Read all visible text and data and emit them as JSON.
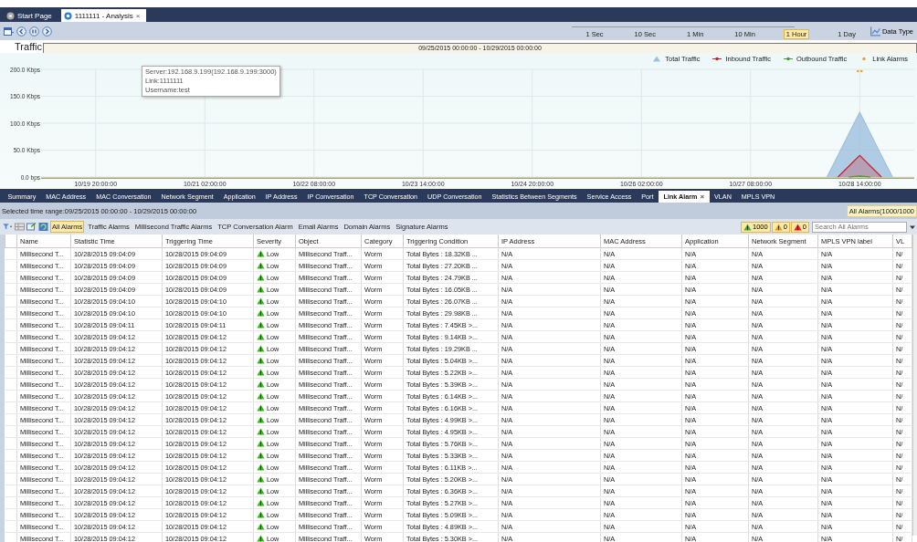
{
  "tabs": [
    {
      "label": "Start Page",
      "selected": false
    },
    {
      "label": "1111111 - Analysis",
      "selected": true,
      "close_mark": "×"
    }
  ],
  "toolbar": {
    "time_scale": [
      {
        "label": "1 Sec",
        "selected": false
      },
      {
        "label": "10 Sec",
        "selected": false
      },
      {
        "label": "1 Min",
        "selected": false
      },
      {
        "label": "10 Min",
        "selected": false
      },
      {
        "label": "1 Hour",
        "selected": true
      },
      {
        "label": "1 Day",
        "selected": false
      }
    ],
    "data_type": "Data Type"
  },
  "tooltip": {
    "lines": [
      "Server:192.168.9.199(192.168.9.199:3000)",
      "Link:1111111",
      "Username:test"
    ]
  },
  "traffic": {
    "title": "Traffic",
    "range": "09/25/2015 00:00:00 - 10/29/2015 00:00:00",
    "alarm_legend": {
      "label": "Link Alarms",
      "color": "#f0a030"
    },
    "chart_data": {
      "type": "area",
      "grid": true,
      "categories": [
        null,
        null,
        null,
        null,
        null,
        "10/19 20:00:00",
        null,
        null,
        null,
        null,
        null,
        null,
        null,
        null,
        null,
        "10/21 02:00:00",
        null,
        null,
        null,
        null,
        null,
        null,
        null,
        null,
        null,
        "10/22 08:00:00",
        null,
        null,
        null,
        null,
        null,
        null,
        null,
        null,
        null,
        "10/23 14:00:00",
        null,
        null,
        null,
        null,
        null,
        null,
        null,
        null,
        null,
        "10/24 20:00:00",
        null,
        null,
        null,
        null,
        null,
        null,
        null,
        null,
        null,
        "10/26 02:00:00",
        null,
        null,
        null,
        null,
        null,
        null,
        null,
        null,
        null,
        "10/27 08:00:00",
        null,
        null,
        null,
        null,
        null,
        null,
        null,
        null,
        null,
        "10/28 14:00:00",
        null,
        null,
        null,
        null,
        null
      ],
      "series": [
        {
          "name": "Total Traffic",
          "color": "#9fbfdf",
          "values": [
            null,
            null,
            null,
            null,
            null,
            null,
            null,
            null,
            null,
            null,
            null,
            null,
            null,
            null,
            null,
            null,
            null,
            null,
            null,
            null,
            null,
            null,
            null,
            null,
            null,
            null,
            null,
            null,
            null,
            null,
            null,
            null,
            null,
            null,
            null,
            null,
            null,
            null,
            null,
            null,
            null,
            null,
            null,
            null,
            null,
            null,
            null,
            null,
            null,
            null,
            null,
            null,
            null,
            null,
            null,
            null,
            null,
            null,
            null,
            null,
            null,
            null,
            null,
            null,
            null,
            null,
            null,
            null,
            null,
            null,
            null,
            null,
            0,
            40,
            80,
            120,
            80,
            40,
            0,
            null,
            null
          ]
        },
        {
          "name": "Inbound Traffic",
          "color": "#c8202a",
          "values": [
            null,
            null,
            null,
            null,
            null,
            null,
            null,
            null,
            null,
            null,
            null,
            null,
            null,
            null,
            null,
            null,
            null,
            null,
            null,
            null,
            null,
            null,
            null,
            null,
            null,
            null,
            null,
            null,
            null,
            null,
            null,
            null,
            null,
            null,
            null,
            null,
            null,
            null,
            null,
            null,
            null,
            null,
            null,
            null,
            null,
            null,
            null,
            null,
            null,
            null,
            null,
            null,
            null,
            null,
            null,
            null,
            null,
            null,
            null,
            null,
            null,
            null,
            null,
            null,
            null,
            null,
            null,
            null,
            null,
            null,
            null,
            null,
            null,
            0,
            20,
            40,
            20,
            0,
            null,
            null,
            null
          ]
        },
        {
          "name": "Outbound Traffic",
          "color": "#4a9a2e",
          "values": [
            null,
            null,
            null,
            null,
            null,
            null,
            null,
            null,
            null,
            null,
            null,
            null,
            null,
            null,
            null,
            null,
            null,
            null,
            null,
            null,
            null,
            null,
            null,
            null,
            null,
            null,
            null,
            null,
            null,
            null,
            null,
            null,
            null,
            null,
            null,
            null,
            null,
            null,
            null,
            null,
            null,
            null,
            null,
            null,
            null,
            null,
            null,
            null,
            null,
            null,
            null,
            null,
            null,
            null,
            null,
            null,
            null,
            null,
            null,
            null,
            null,
            null,
            null,
            null,
            null,
            null,
            null,
            null,
            null,
            null,
            null,
            null,
            null,
            null,
            0,
            2,
            0,
            null,
            null,
            null,
            null
          ]
        }
      ],
      "ylim": [
        0,
        200
      ],
      "yticks": [
        {
          "value": 0,
          "label": "0.0 bps"
        },
        {
          "value": 50,
          "label": "50.0 Kbps"
        },
        {
          "value": 100,
          "label": "100.0 Kbps"
        },
        {
          "value": 150,
          "label": "150.0 Kbps"
        },
        {
          "value": 200,
          "label": "200.0 Kbps"
        }
      ]
    }
  },
  "view_tabs": [
    {
      "label": "Summary",
      "selected": false
    },
    {
      "label": "MAC Address",
      "selected": false
    },
    {
      "label": "MAC Conversation",
      "selected": false
    },
    {
      "label": "Network Segment",
      "selected": false
    },
    {
      "label": "Application",
      "selected": false
    },
    {
      "label": "IP Address",
      "selected": false
    },
    {
      "label": "IP Conversation",
      "selected": false
    },
    {
      "label": "TCP Conversation",
      "selected": false
    },
    {
      "label": "UDP Conversation",
      "selected": false
    },
    {
      "label": "Statistics Between Segments",
      "selected": false
    },
    {
      "label": "Service Access",
      "selected": false
    },
    {
      "label": "Port",
      "selected": false
    },
    {
      "label": "Link Alarm",
      "selected": true,
      "close_mark": "×"
    },
    {
      "label": "VLAN",
      "selected": false
    },
    {
      "label": "MPLS VPN",
      "selected": false
    }
  ],
  "range_bar": {
    "text": "Selected time range:09/25/2015 00:00:00 - 10/29/2015 00:00:00",
    "summary": "All Alarms(1000/1000"
  },
  "alarm_filters": [
    {
      "label": "All Alarms",
      "selected": true
    },
    {
      "label": "Traffic Alarms",
      "selected": false
    },
    {
      "label": "Millisecond Traffic Alarms",
      "selected": false
    },
    {
      "label": "TCP Conversation Alarm",
      "selected": false
    },
    {
      "label": "Email Alarms",
      "selected": false
    },
    {
      "label": "Domain Alarms",
      "selected": false
    },
    {
      "label": "Signature Alarms",
      "selected": false
    }
  ],
  "alarm_counts": [
    {
      "count": "1000",
      "color": "#3cb521"
    },
    {
      "count": "0",
      "color": "#f0a000"
    },
    {
      "count": "0",
      "color": "#e02020"
    }
  ],
  "search": {
    "placeholder": "Search All Alarms"
  },
  "table": {
    "columns": [
      {
        "label": "Name",
        "kind": "text"
      },
      {
        "label": "Statistic Time",
        "kind": "text"
      },
      {
        "label": "Triggering Time",
        "kind": "text"
      },
      {
        "label": "Severity",
        "kind": "severity"
      },
      {
        "label": "Object",
        "kind": "text"
      },
      {
        "label": "Category",
        "kind": "text"
      },
      {
        "label": "Triggering Condition",
        "kind": "text"
      },
      {
        "label": "IP Address",
        "kind": "text"
      },
      {
        "label": "MAC Address",
        "kind": "text"
      },
      {
        "label": "Application",
        "kind": "text"
      },
      {
        "label": "Network Segment",
        "kind": "text"
      },
      {
        "label": "MPLS VPN label",
        "kind": "text"
      },
      {
        "label": "VL",
        "kind": "text"
      }
    ],
    "rows": [
      [
        "Millisecond T...",
        "10/28/2015 09:04:09",
        "10/28/2015 09:04:09",
        "Low",
        "Millisecond Traff...",
        "Worm",
        "Total Bytes : 18.32KB ...",
        "N/A",
        "N/A",
        "N/A",
        "N/A",
        "N/A",
        "N/"
      ],
      [
        "Millisecond T...",
        "10/28/2015 09:04:09",
        "10/28/2015 09:04:09",
        "Low",
        "Millisecond Traff...",
        "Worm",
        "Total Bytes : 27.20KB ...",
        "N/A",
        "N/A",
        "N/A",
        "N/A",
        "N/A",
        "N/"
      ],
      [
        "Millisecond T...",
        "10/28/2015 09:04:09",
        "10/28/2015 09:04:09",
        "Low",
        "Millisecond Traff...",
        "Worm",
        "Total Bytes : 24.79KB ...",
        "N/A",
        "N/A",
        "N/A",
        "N/A",
        "N/A",
        "N/"
      ],
      [
        "Millisecond T...",
        "10/28/2015 09:04:09",
        "10/28/2015 09:04:09",
        "Low",
        "Millisecond Traff...",
        "Worm",
        "Total Bytes : 16.05KB ...",
        "N/A",
        "N/A",
        "N/A",
        "N/A",
        "N/A",
        "N/"
      ],
      [
        "Millisecond T...",
        "10/28/2015 09:04:10",
        "10/28/2015 09:04:10",
        "Low",
        "Millisecond Traff...",
        "Worm",
        "Total Bytes : 26.07KB ...",
        "N/A",
        "N/A",
        "N/A",
        "N/A",
        "N/A",
        "N/"
      ],
      [
        "Millisecond T...",
        "10/28/2015 09:04:10",
        "10/28/2015 09:04:10",
        "Low",
        "Millisecond Traff...",
        "Worm",
        "Total Bytes : 29.98KB ...",
        "N/A",
        "N/A",
        "N/A",
        "N/A",
        "N/A",
        "N/"
      ],
      [
        "Millisecond T...",
        "10/28/2015 09:04:11",
        "10/28/2015 09:04:11",
        "Low",
        "Millisecond Traff...",
        "Worm",
        "Total Bytes : 7.45KB >...",
        "N/A",
        "N/A",
        "N/A",
        "N/A",
        "N/A",
        "N/"
      ],
      [
        "Millisecond T...",
        "10/28/2015 09:04:12",
        "10/28/2015 09:04:12",
        "Low",
        "Millisecond Traff...",
        "Worm",
        "Total Bytes : 9.14KB >...",
        "N/A",
        "N/A",
        "N/A",
        "N/A",
        "N/A",
        "N/"
      ],
      [
        "Millisecond T...",
        "10/28/2015 09:04:12",
        "10/28/2015 09:04:12",
        "Low",
        "Millisecond Traff...",
        "Worm",
        "Total Bytes : 19.29KB ...",
        "N/A",
        "N/A",
        "N/A",
        "N/A",
        "N/A",
        "N/"
      ],
      [
        "Millisecond T...",
        "10/28/2015 09:04:12",
        "10/28/2015 09:04:12",
        "Low",
        "Millisecond Traff...",
        "Worm",
        "Total Bytes : 5.04KB >...",
        "N/A",
        "N/A",
        "N/A",
        "N/A",
        "N/A",
        "N/"
      ],
      [
        "Millisecond T...",
        "10/28/2015 09:04:12",
        "10/28/2015 09:04:12",
        "Low",
        "Millisecond Traff...",
        "Worm",
        "Total Bytes : 5.22KB >...",
        "N/A",
        "N/A",
        "N/A",
        "N/A",
        "N/A",
        "N/"
      ],
      [
        "Millisecond T...",
        "10/28/2015 09:04:12",
        "10/28/2015 09:04:12",
        "Low",
        "Millisecond Traff...",
        "Worm",
        "Total Bytes : 5.39KB >...",
        "N/A",
        "N/A",
        "N/A",
        "N/A",
        "N/A",
        "N/"
      ],
      [
        "Millisecond T...",
        "10/28/2015 09:04:12",
        "10/28/2015 09:04:12",
        "Low",
        "Millisecond Traff...",
        "Worm",
        "Total Bytes : 6.14KB >...",
        "N/A",
        "N/A",
        "N/A",
        "N/A",
        "N/A",
        "N/"
      ],
      [
        "Millisecond T...",
        "10/28/2015 09:04:12",
        "10/28/2015 09:04:12",
        "Low",
        "Millisecond Traff...",
        "Worm",
        "Total Bytes : 6.16KB >...",
        "N/A",
        "N/A",
        "N/A",
        "N/A",
        "N/A",
        "N/"
      ],
      [
        "Millisecond T...",
        "10/28/2015 09:04:12",
        "10/28/2015 09:04:12",
        "Low",
        "Millisecond Traff...",
        "Worm",
        "Total Bytes : 4.99KB >...",
        "N/A",
        "N/A",
        "N/A",
        "N/A",
        "N/A",
        "N/"
      ],
      [
        "Millisecond T...",
        "10/28/2015 09:04:12",
        "10/28/2015 09:04:12",
        "Low",
        "Millisecond Traff...",
        "Worm",
        "Total Bytes : 4.95KB >...",
        "N/A",
        "N/A",
        "N/A",
        "N/A",
        "N/A",
        "N/"
      ],
      [
        "Millisecond T...",
        "10/28/2015 09:04:12",
        "10/28/2015 09:04:12",
        "Low",
        "Millisecond Traff...",
        "Worm",
        "Total Bytes : 5.76KB >...",
        "N/A",
        "N/A",
        "N/A",
        "N/A",
        "N/A",
        "N/"
      ],
      [
        "Millisecond T...",
        "10/28/2015 09:04:12",
        "10/28/2015 09:04:12",
        "Low",
        "Millisecond Traff...",
        "Worm",
        "Total Bytes : 5.33KB >...",
        "N/A",
        "N/A",
        "N/A",
        "N/A",
        "N/A",
        "N/"
      ],
      [
        "Millisecond T...",
        "10/28/2015 09:04:12",
        "10/28/2015 09:04:12",
        "Low",
        "Millisecond Traff...",
        "Worm",
        "Total Bytes : 6.11KB >...",
        "N/A",
        "N/A",
        "N/A",
        "N/A",
        "N/A",
        "N/"
      ],
      [
        "Millisecond T...",
        "10/28/2015 09:04:12",
        "10/28/2015 09:04:12",
        "Low",
        "Millisecond Traff...",
        "Worm",
        "Total Bytes : 5.20KB >...",
        "N/A",
        "N/A",
        "N/A",
        "N/A",
        "N/A",
        "N/"
      ],
      [
        "Millisecond T...",
        "10/28/2015 09:04:12",
        "10/28/2015 09:04:12",
        "Low",
        "Millisecond Traff...",
        "Worm",
        "Total Bytes : 6.36KB >...",
        "N/A",
        "N/A",
        "N/A",
        "N/A",
        "N/A",
        "N/"
      ],
      [
        "Millisecond T...",
        "10/28/2015 09:04:12",
        "10/28/2015 09:04:12",
        "Low",
        "Millisecond Traff...",
        "Worm",
        "Total Bytes : 5.27KB >...",
        "N/A",
        "N/A",
        "N/A",
        "N/A",
        "N/A",
        "N/"
      ],
      [
        "Millisecond T...",
        "10/28/2015 09:04:12",
        "10/28/2015 09:04:12",
        "Low",
        "Millisecond Traff...",
        "Worm",
        "Total Bytes : 5.09KB >...",
        "N/A",
        "N/A",
        "N/A",
        "N/A",
        "N/A",
        "N/"
      ],
      [
        "Millisecond T...",
        "10/28/2015 09:04:12",
        "10/28/2015 09:04:12",
        "Low",
        "Millisecond Traff...",
        "Worm",
        "Total Bytes : 4.89KB >...",
        "N/A",
        "N/A",
        "N/A",
        "N/A",
        "N/A",
        "N/"
      ],
      [
        "Millisecond T...",
        "10/28/2015 09:04:12",
        "10/28/2015 09:04:12",
        "Low",
        "Millisecond Traff...",
        "Worm",
        "Total Bytes : 5.30KB >...",
        "N/A",
        "N/A",
        "N/A",
        "N/A",
        "N/A",
        "N/"
      ]
    ]
  }
}
